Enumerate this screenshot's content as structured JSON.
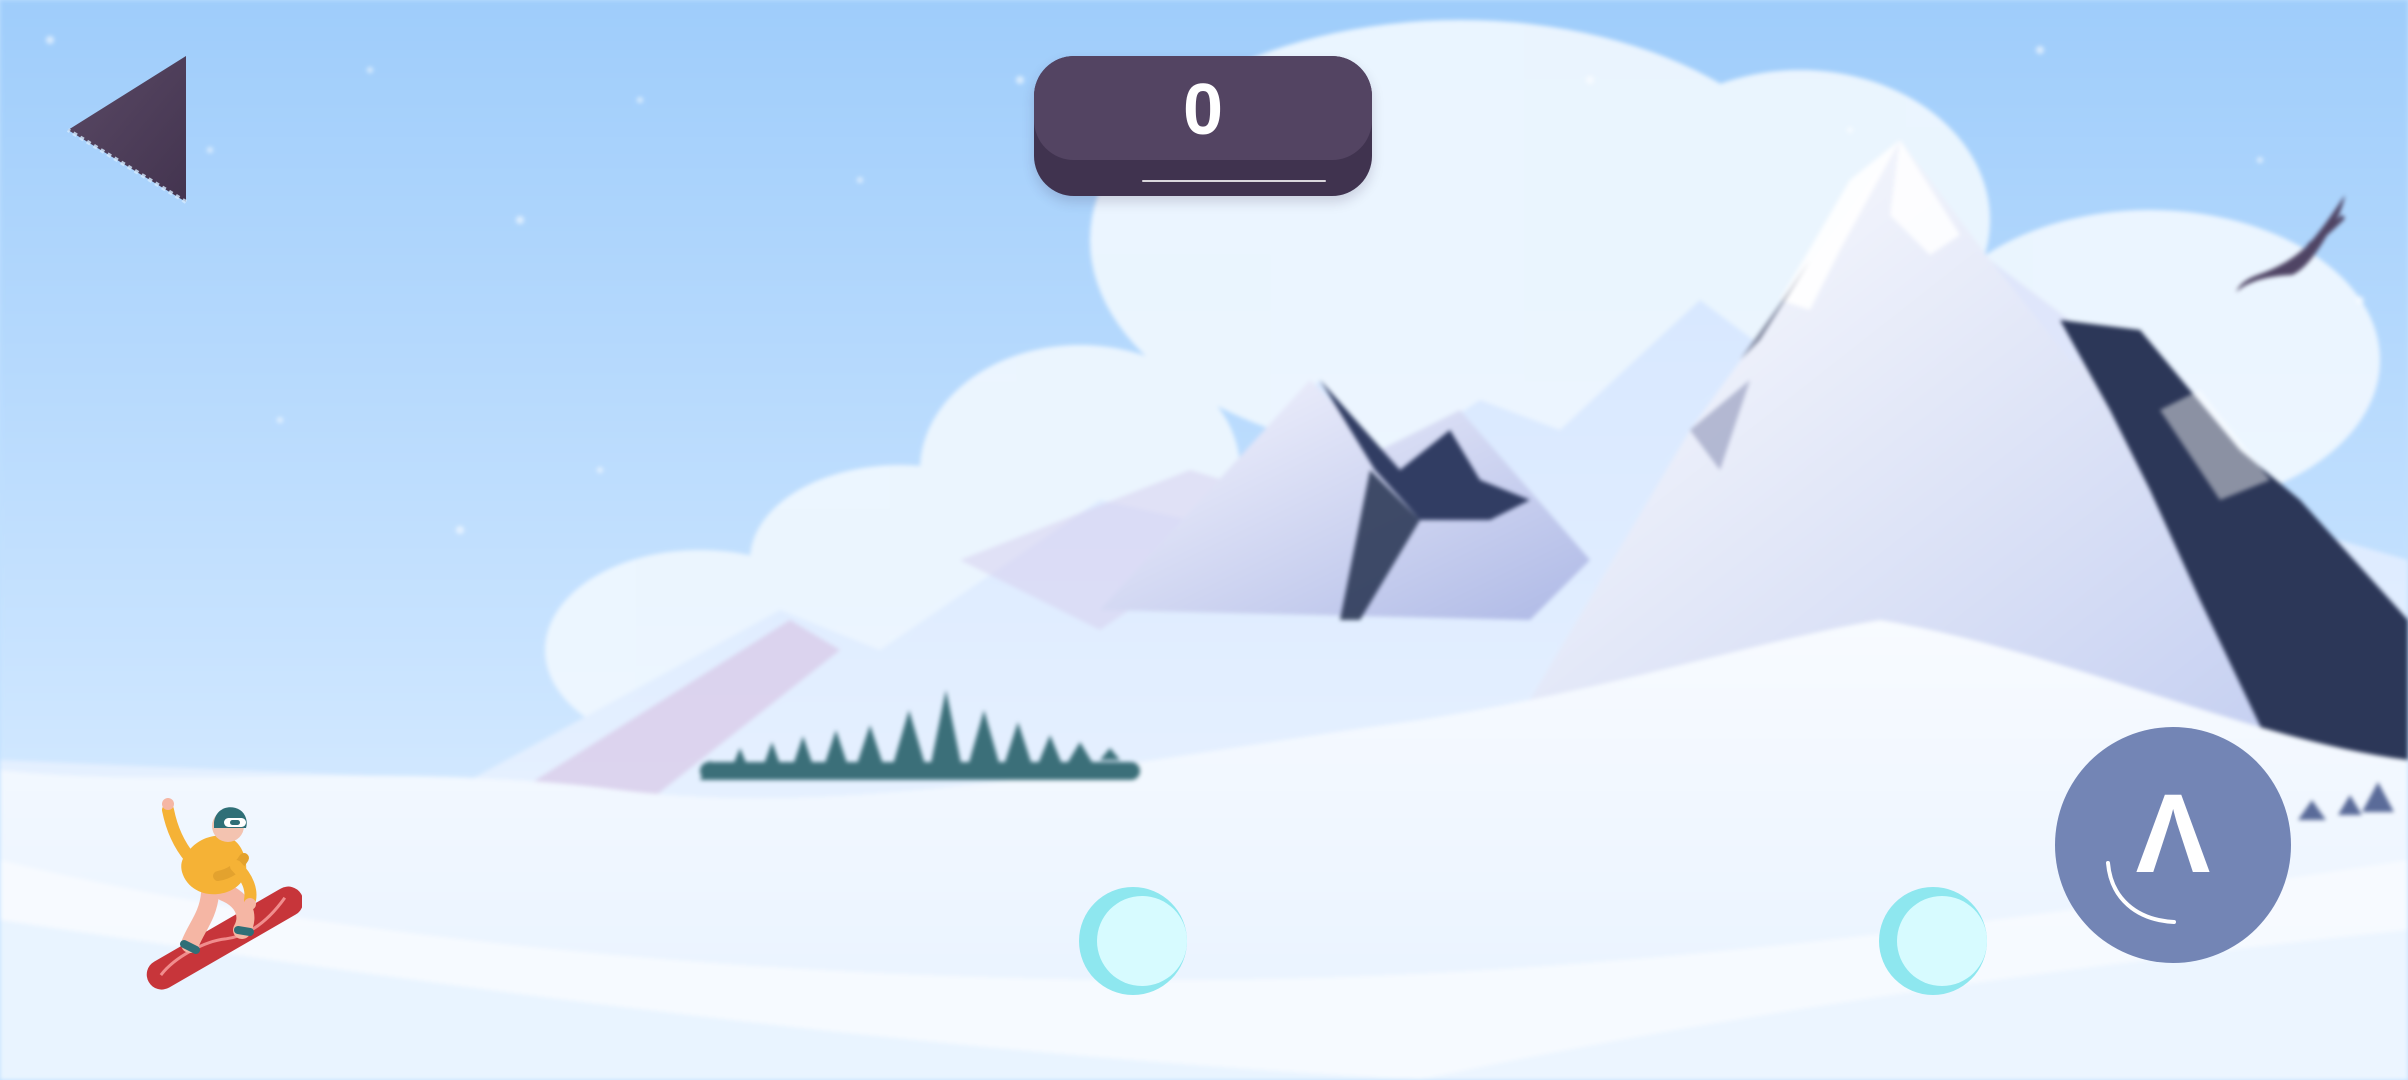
{
  "hud": {
    "back_label": "Back",
    "score": "0",
    "jump_label": "Jump",
    "jump_glyph": "Λ"
  },
  "icons": {
    "back": "triangle-left-icon",
    "jump": "caret-up-icon",
    "coin": "coin-icon",
    "player": "snowboarder",
    "bird": "eagle"
  },
  "colors": {
    "sky_top": "#a8d0fb",
    "sky_bottom": "#d9ecff",
    "snow": "#f7fbff",
    "hud_dark": "#40334f",
    "hud_face": "#534462",
    "jump_button": "#7385b5",
    "mountain_shadow": "#2b3758",
    "pine": "#3c6c79",
    "coin": "#d7fbff",
    "coin_shadow": "#8ee7ef"
  }
}
